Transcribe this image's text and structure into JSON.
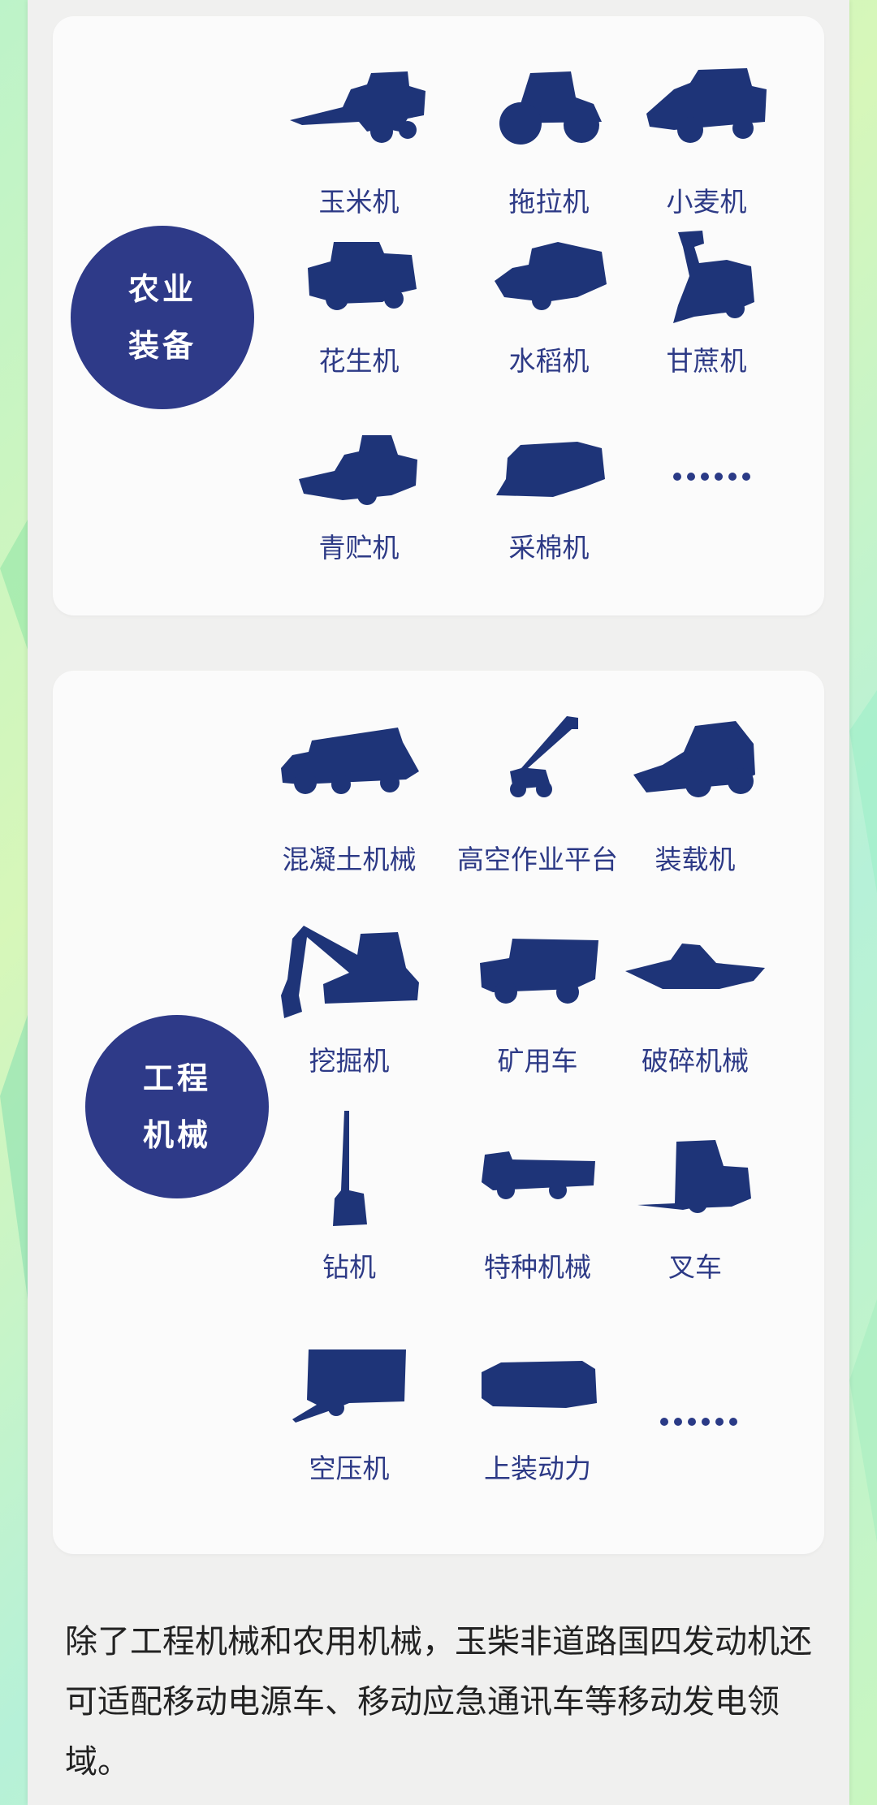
{
  "agri": {
    "title_l1": "农业",
    "title_l2": "装备",
    "items": [
      {
        "label": "玉米机",
        "icon": "corn-harvester-icon"
      },
      {
        "label": "拖拉机",
        "icon": "tractor-icon"
      },
      {
        "label": "小麦机",
        "icon": "wheat-harvester-icon"
      },
      {
        "label": "花生机",
        "icon": "peanut-harvester-icon"
      },
      {
        "label": "水稻机",
        "icon": "rice-harvester-icon"
      },
      {
        "label": "甘蔗机",
        "icon": "sugarcane-harvester-icon"
      },
      {
        "label": "青贮机",
        "icon": "silage-harvester-icon"
      },
      {
        "label": "采棉机",
        "icon": "cotton-picker-icon"
      }
    ],
    "more": "……"
  },
  "eng": {
    "title_l1": "工程",
    "title_l2": "机械",
    "items": [
      {
        "label": "混凝土机械",
        "icon": "concrete-truck-icon"
      },
      {
        "label": "高空作业平台",
        "icon": "aerial-platform-icon"
      },
      {
        "label": "装载机",
        "icon": "loader-icon"
      },
      {
        "label": "挖掘机",
        "icon": "excavator-icon"
      },
      {
        "label": "矿用车",
        "icon": "mining-truck-icon"
      },
      {
        "label": "破碎机械",
        "icon": "crusher-icon"
      },
      {
        "label": "钻机",
        "icon": "drill-rig-icon"
      },
      {
        "label": "特种机械",
        "icon": "special-vehicle-icon"
      },
      {
        "label": "叉车",
        "icon": "forklift-icon"
      },
      {
        "label": "空压机",
        "icon": "air-compressor-icon"
      },
      {
        "label": "上装动力",
        "icon": "upper-power-unit-icon"
      }
    ],
    "more": "……"
  },
  "paragraph": "除了工程机械和农用机械，玉柴非道路国四发动机还可适配移动电源车、移动应急通讯车等移动发电领域。",
  "colors": {
    "accent": "#2e3a88",
    "machine": "#1e3478",
    "label": "#2d3a86"
  }
}
